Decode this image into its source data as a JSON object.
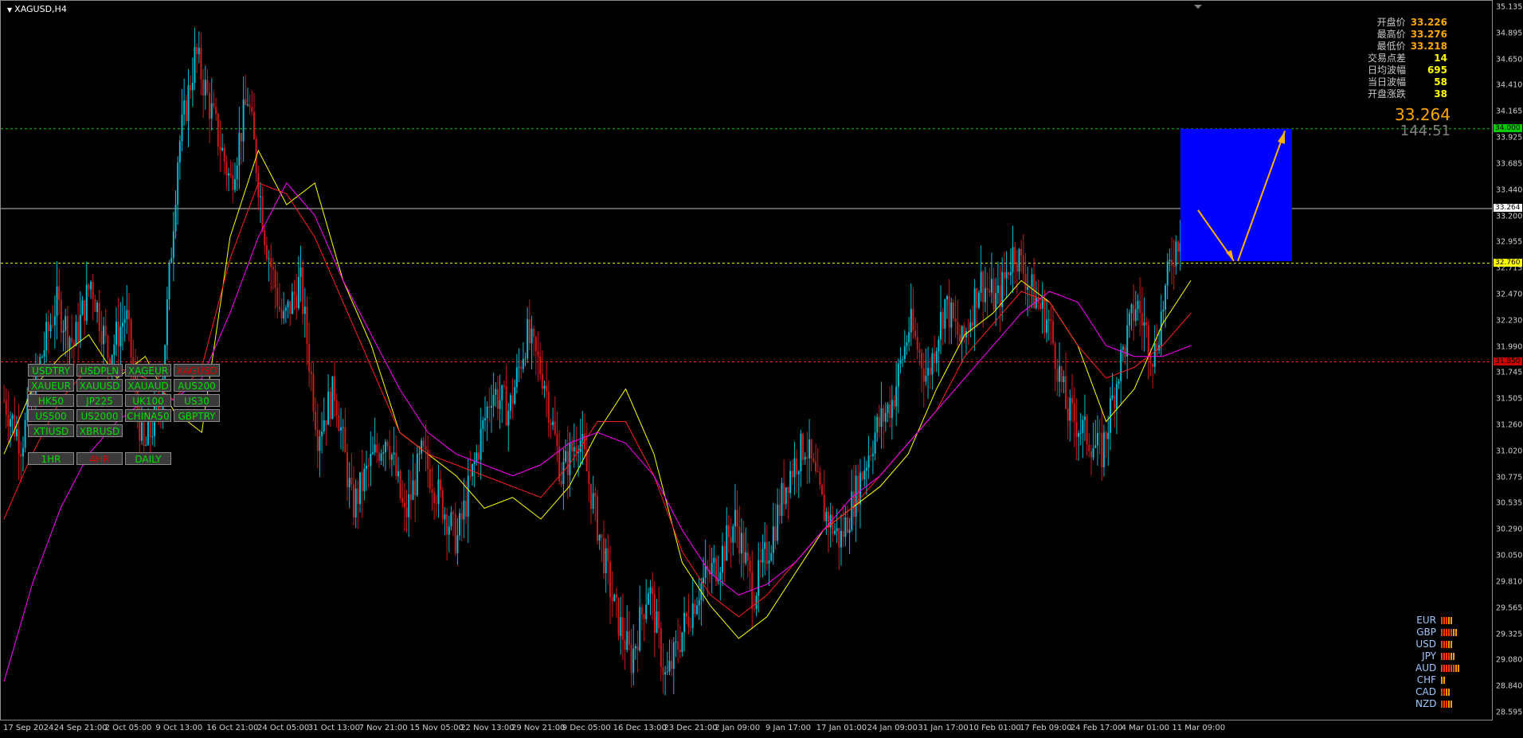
{
  "window": {
    "symbol_title": "XAGUSD,H4"
  },
  "info_panel": [
    {
      "label": "开盘价",
      "value": "33.226",
      "color": "#ffa500"
    },
    {
      "label": "最高价",
      "value": "33.276",
      "color": "#ffa500"
    },
    {
      "label": "最低价",
      "value": "33.218",
      "color": "#ffa500"
    },
    {
      "label": "交易点差",
      "value": "14",
      "color": "#ffff00"
    },
    {
      "label": "日均波幅",
      "value": "695",
      "color": "#ffff00"
    },
    {
      "label": "当日波幅",
      "value": "58",
      "color": "#ffff00"
    },
    {
      "label": "开盘涨跌",
      "value": "38",
      "color": "#ffff00"
    }
  ],
  "big_price": "33.264",
  "countdown": "144:51",
  "symbol_buttons": [
    {
      "label": "USDTRY",
      "active": false
    },
    {
      "label": "USDPLN",
      "active": false
    },
    {
      "label": "XAGEUR",
      "active": false
    },
    {
      "label": "XAGUSD",
      "active": true
    },
    {
      "label": "XAUEUR",
      "active": false
    },
    {
      "label": "XAUUSD",
      "active": false
    },
    {
      "label": "XAUAUD",
      "active": false
    },
    {
      "label": "AUS200",
      "active": false
    },
    {
      "label": "HK50",
      "active": false
    },
    {
      "label": "JP225",
      "active": false
    },
    {
      "label": "UK100",
      "active": false
    },
    {
      "label": "US30",
      "active": false
    },
    {
      "label": "US500",
      "active": false
    },
    {
      "label": "US2000",
      "active": false
    },
    {
      "label": "CHINA50",
      "active": false
    },
    {
      "label": "GBPTRY",
      "active": false
    },
    {
      "label": "XTIUSD",
      "active": false
    },
    {
      "label": "XBRUSD",
      "active": false
    }
  ],
  "timeframe_buttons": [
    {
      "label": "1HR",
      "active": false
    },
    {
      "label": "4HR",
      "active": true
    },
    {
      "label": "DAILY",
      "active": false
    }
  ],
  "currency_strength": [
    {
      "label": "EUR",
      "bars": 5
    },
    {
      "label": "GBP",
      "bars": 7
    },
    {
      "label": "USD",
      "bars": 5
    },
    {
      "label": "JPY",
      "bars": 6
    },
    {
      "label": "AUD",
      "bars": 8
    },
    {
      "label": "CHF",
      "bars": 2
    },
    {
      "label": "CAD",
      "bars": 4
    },
    {
      "label": "NZD",
      "bars": 5
    }
  ],
  "price_axis": {
    "ticks": [
      "35.135",
      "34.895",
      "34.650",
      "34.410",
      "34.165",
      "33.925",
      "33.685",
      "33.440",
      "33.200",
      "32.955",
      "32.715",
      "32.470",
      "32.230",
      "31.990",
      "31.745",
      "31.505",
      "31.260",
      "31.020",
      "30.775",
      "30.535",
      "30.290",
      "30.050",
      "29.810",
      "29.565",
      "29.325",
      "29.080",
      "28.840",
      "28.595"
    ],
    "max": 35.18,
    "min": 28.55,
    "tags": [
      {
        "value": "34.000",
        "price": 34.0,
        "bg": "#00cc00"
      },
      {
        "value": "33.264",
        "price": 33.264,
        "bg": "#ffffff"
      },
      {
        "value": "32.760",
        "price": 32.76,
        "bg": "#ffff00"
      },
      {
        "value": "31.850",
        "price": 31.85,
        "bg": "#cc0000"
      }
    ]
  },
  "time_axis": [
    "17 Sep 2024",
    "24 Sep 21:00",
    "2 Oct 05:00",
    "9 Oct 13:00",
    "16 Oct 21:00",
    "24 Oct 05:00",
    "31 Oct 13:00",
    "7 Nov 21:00",
    "15 Nov 05:00",
    "22 Nov 13:00",
    "29 Nov 21:00",
    "9 Dec 05:00",
    "16 Dec 13:00",
    "23 Dec 21:00",
    "2 Jan 09:00",
    "9 Jan 17:00",
    "17 Jan 01:00",
    "24 Jan 09:00",
    "31 Jan 17:00",
    "10 Feb 01:00",
    "17 Feb 09:00",
    "24 Feb 17:00",
    "4 Mar 01:00",
    "11 Mar 09:00"
  ],
  "levels": [
    {
      "price": 34.0,
      "color": "#00cc00",
      "style": "dashed"
    },
    {
      "price": 33.264,
      "color": "#c0c0c0",
      "style": "solid"
    },
    {
      "price": 32.76,
      "color": "#ffff00",
      "style": "dashed"
    },
    {
      "price": 31.85,
      "color": "#ff2020",
      "style": "dashed"
    }
  ],
  "colors": {
    "bull": "#00bcd4",
    "bear": "#d01818",
    "ma_fast": "#ffff00",
    "ma_mid": "#ff2020",
    "ma_slow": "#ff00ff",
    "zone": "#0000ff",
    "arrow": "#ffb000"
  },
  "chart_data": {
    "type": "candlestick",
    "close_path": [
      31.5,
      31.1,
      31.8,
      32.4,
      32.0,
      32.6,
      31.9,
      32.3,
      31.0,
      31.5,
      33.8,
      34.7,
      34.1,
      33.5,
      34.3,
      33.0,
      32.2,
      32.6,
      31.2,
      31.6,
      30.5,
      30.9,
      31.2,
      30.4,
      31.0,
      30.6,
      30.2,
      30.9,
      31.6,
      31.4,
      32.1,
      31.7,
      30.8,
      31.2,
      30.4,
      29.6,
      29.1,
      29.8,
      28.9,
      29.4,
      29.8,
      30.0,
      30.4,
      29.7,
      30.2,
      30.8,
      31.1,
      30.5,
      30.2,
      30.7,
      31.2,
      31.5,
      32.2,
      31.7,
      32.4,
      32.0,
      32.6,
      32.4,
      32.9,
      32.5,
      32.2,
      31.4,
      31.2,
      31.0,
      31.8,
      32.4,
      31.9,
      32.8,
      33.3
    ],
    "ma": [
      {
        "values": [
          31.0,
          31.6,
          31.9,
          32.1,
          31.7,
          31.9,
          31.4,
          31.2,
          33.0,
          33.8,
          33.3,
          33.5,
          32.6,
          32.0,
          31.2,
          31.0,
          30.8,
          30.5,
          30.6,
          30.4,
          30.7,
          31.2,
          31.6,
          31.0,
          30.0,
          29.6,
          29.3,
          29.5,
          29.9,
          30.3,
          30.5,
          30.7,
          31.0,
          31.6,
          32.1,
          32.3,
          32.6,
          32.4,
          32.0,
          31.3,
          31.6,
          32.2,
          32.6
        ]
      },
      {
        "values": [
          30.4,
          31.0,
          31.5,
          31.8,
          31.8,
          31.7,
          31.5,
          31.8,
          32.8,
          33.5,
          33.4,
          33.0,
          32.4,
          31.8,
          31.2,
          31.0,
          30.9,
          30.8,
          30.7,
          30.6,
          30.9,
          31.3,
          31.3,
          30.8,
          30.1,
          29.7,
          29.5,
          29.7,
          30.0,
          30.3,
          30.5,
          30.8,
          31.1,
          31.4,
          31.9,
          32.2,
          32.5,
          32.4,
          32.0,
          31.7,
          31.8,
          32.0,
          32.3
        ]
      },
      {
        "values": [
          28.9,
          29.8,
          30.5,
          31.0,
          31.3,
          31.5,
          31.5,
          31.7,
          32.3,
          33.0,
          33.5,
          33.2,
          32.6,
          32.1,
          31.6,
          31.2,
          31.0,
          30.9,
          30.8,
          30.9,
          31.1,
          31.2,
          31.1,
          30.8,
          30.3,
          29.9,
          29.7,
          29.8,
          30.0,
          30.3,
          30.6,
          30.8,
          31.1,
          31.4,
          31.7,
          32.0,
          32.3,
          32.5,
          32.4,
          32.0,
          31.9,
          31.9,
          32.0
        ]
      }
    ]
  }
}
